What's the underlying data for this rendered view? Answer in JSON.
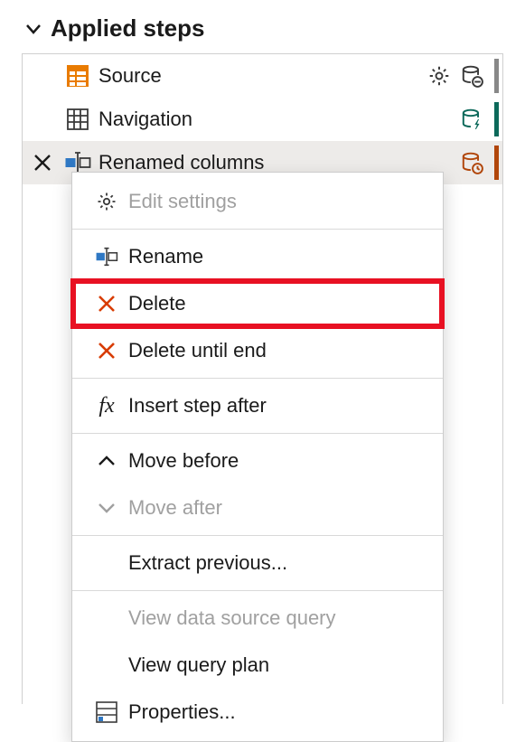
{
  "section_title": "Applied steps",
  "steps": [
    {
      "label": "Source",
      "icon": "table-orange-icon",
      "x_visible": false,
      "right": [
        "gear",
        "db-minus"
      ],
      "edge": "gray",
      "selected": false
    },
    {
      "label": "Navigation",
      "icon": "grid-icon",
      "x_visible": false,
      "right": [
        "db-bolt"
      ],
      "edge": "teal",
      "selected": false
    },
    {
      "label": "Renamed columns",
      "icon": "rename-icon",
      "x_visible": true,
      "right": [
        "db-clock"
      ],
      "edge": "orange",
      "selected": true
    }
  ],
  "context_menu": [
    {
      "label": "Edit settings",
      "icon": "gear",
      "disabled": true,
      "highlighted": false
    },
    "sep",
    {
      "label": "Rename",
      "icon": "rename",
      "disabled": false,
      "highlighted": false
    },
    {
      "label": "Delete",
      "icon": "x-red",
      "disabled": false,
      "highlighted": true
    },
    {
      "label": "Delete until end",
      "icon": "x-red",
      "disabled": false,
      "highlighted": false
    },
    "sep",
    {
      "label": "Insert step after",
      "icon": "fx",
      "disabled": false,
      "highlighted": false
    },
    "sep",
    {
      "label": "Move before",
      "icon": "chev-up",
      "disabled": false,
      "highlighted": false
    },
    {
      "label": "Move after",
      "icon": "chev-down",
      "disabled": true,
      "highlighted": false
    },
    "sep",
    {
      "label": "Extract previous...",
      "icon": "",
      "disabled": false,
      "highlighted": false
    },
    "sep",
    {
      "label": "View data source query",
      "icon": "",
      "disabled": true,
      "highlighted": false
    },
    {
      "label": "View query plan",
      "icon": "",
      "disabled": false,
      "highlighted": false
    },
    {
      "label": "Properties...",
      "icon": "props",
      "disabled": false,
      "highlighted": false
    }
  ]
}
